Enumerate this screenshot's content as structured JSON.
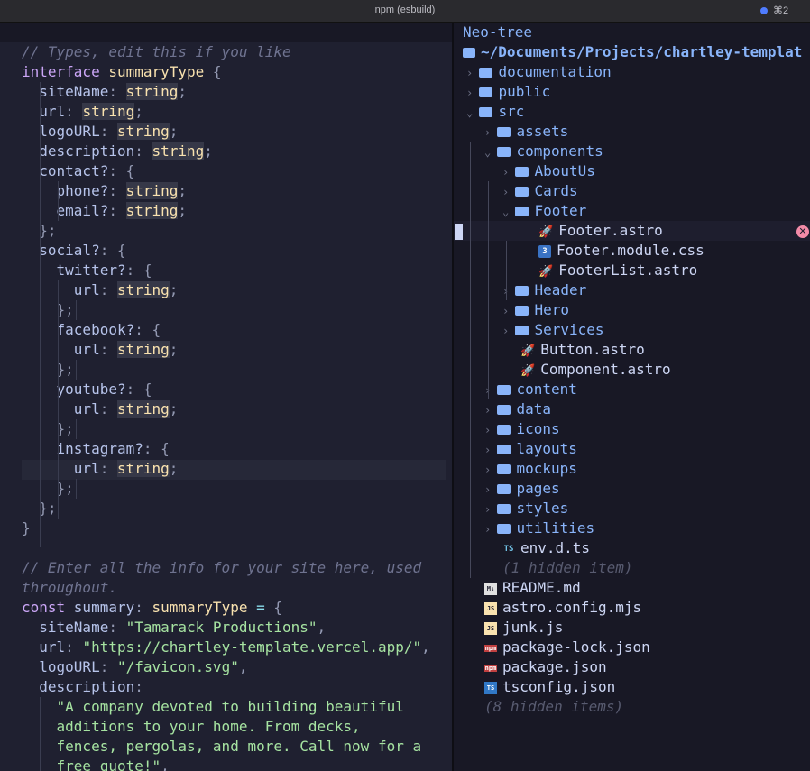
{
  "titlebar": {
    "title": "npm (esbuild)",
    "shortcut": "⌘2"
  },
  "editor": {
    "lines": [
      {
        "n": "l1",
        "segs": [
          [
            "c-cm",
            "// Types, edit this if you like"
          ]
        ]
      },
      {
        "n": "l2",
        "segs": [
          [
            "c-kw",
            "interface "
          ],
          [
            "c-ty",
            "summaryType "
          ],
          [
            "c-pun",
            "{"
          ]
        ]
      },
      {
        "n": "l3",
        "segs": [
          [
            "",
            "  "
          ],
          [
            "c-prop",
            "siteName"
          ],
          [
            "c-pun",
            ": "
          ],
          [
            "c-hl",
            "string"
          ],
          [
            "c-pun",
            ";"
          ]
        ]
      },
      {
        "n": "l4",
        "segs": [
          [
            "",
            "  "
          ],
          [
            "c-prop",
            "url"
          ],
          [
            "c-pun",
            ": "
          ],
          [
            "c-hl",
            "string"
          ],
          [
            "c-pun",
            ";"
          ]
        ]
      },
      {
        "n": "l5",
        "segs": [
          [
            "",
            "  "
          ],
          [
            "c-prop",
            "logoURL"
          ],
          [
            "c-pun",
            ": "
          ],
          [
            "c-hl",
            "string"
          ],
          [
            "c-pun",
            ";"
          ]
        ]
      },
      {
        "n": "l6",
        "segs": [
          [
            "",
            "  "
          ],
          [
            "c-prop",
            "description"
          ],
          [
            "c-pun",
            ": "
          ],
          [
            "c-hl",
            "string"
          ],
          [
            "c-pun",
            ";"
          ]
        ]
      },
      {
        "n": "l7",
        "segs": [
          [
            "",
            "  "
          ],
          [
            "c-prop",
            "contact?"
          ],
          [
            "c-pun",
            ": {"
          ]
        ]
      },
      {
        "n": "l8",
        "segs": [
          [
            "",
            "    "
          ],
          [
            "c-prop",
            "phone?"
          ],
          [
            "c-pun",
            ": "
          ],
          [
            "c-hl",
            "string"
          ],
          [
            "c-pun",
            ";"
          ]
        ]
      },
      {
        "n": "l9",
        "segs": [
          [
            "",
            "    "
          ],
          [
            "c-prop",
            "email?"
          ],
          [
            "c-pun",
            ": "
          ],
          [
            "c-hl",
            "string"
          ],
          [
            "c-pun",
            ";"
          ]
        ]
      },
      {
        "n": "l10",
        "segs": [
          [
            "c-pun",
            "  };"
          ]
        ]
      },
      {
        "n": "l11",
        "segs": [
          [
            "",
            "  "
          ],
          [
            "c-prop",
            "social?"
          ],
          [
            "c-pun",
            ": {"
          ]
        ]
      },
      {
        "n": "l12",
        "segs": [
          [
            "",
            "    "
          ],
          [
            "c-prop",
            "twitter?"
          ],
          [
            "c-pun",
            ": {"
          ]
        ]
      },
      {
        "n": "l13",
        "segs": [
          [
            "",
            "      "
          ],
          [
            "c-prop",
            "url"
          ],
          [
            "c-pun",
            ": "
          ],
          [
            "c-hl",
            "string"
          ],
          [
            "c-pun",
            ";"
          ]
        ]
      },
      {
        "n": "l14",
        "segs": [
          [
            "c-pun",
            "    };"
          ]
        ]
      },
      {
        "n": "l15",
        "segs": [
          [
            "",
            "    "
          ],
          [
            "c-prop",
            "facebook?"
          ],
          [
            "c-pun",
            ": {"
          ]
        ]
      },
      {
        "n": "l16",
        "segs": [
          [
            "",
            "      "
          ],
          [
            "c-prop",
            "url"
          ],
          [
            "c-pun",
            ": "
          ],
          [
            "c-hl",
            "string"
          ],
          [
            "c-pun",
            ";"
          ]
        ]
      },
      {
        "n": "l17",
        "segs": [
          [
            "c-pun",
            "    };"
          ]
        ]
      },
      {
        "n": "l18",
        "segs": [
          [
            "",
            "    "
          ],
          [
            "c-prop",
            "youtube?"
          ],
          [
            "c-pun",
            ": {"
          ]
        ]
      },
      {
        "n": "l19",
        "segs": [
          [
            "",
            "      "
          ],
          [
            "c-prop",
            "url"
          ],
          [
            "c-pun",
            ": "
          ],
          [
            "c-hl",
            "string"
          ],
          [
            "c-pun",
            ";"
          ]
        ]
      },
      {
        "n": "l20",
        "segs": [
          [
            "c-pun",
            "    };"
          ]
        ]
      },
      {
        "n": "l21",
        "segs": [
          [
            "",
            "    "
          ],
          [
            "c-prop",
            "instagram?"
          ],
          [
            "c-pun",
            ": {"
          ]
        ]
      },
      {
        "n": "l22",
        "segs": [
          [
            "",
            "      "
          ],
          [
            "c-prop",
            "url"
          ],
          [
            "c-pun",
            ": "
          ],
          [
            "c-hl",
            "string"
          ],
          [
            "c-pun",
            ";"
          ]
        ]
      },
      {
        "n": "l23",
        "segs": [
          [
            "c-pun",
            "    };"
          ]
        ]
      },
      {
        "n": "l24",
        "segs": [
          [
            "c-pun",
            "  };"
          ]
        ]
      },
      {
        "n": "l25",
        "segs": [
          [
            "c-pun",
            "}"
          ]
        ]
      },
      {
        "n": "l26",
        "segs": [
          [
            "",
            ""
          ]
        ]
      },
      {
        "n": "l27",
        "segs": [
          [
            "c-cm",
            "// Enter all the info for your site here, used"
          ]
        ]
      },
      {
        "n": "l28",
        "segs": [
          [
            "c-cm",
            "throughout."
          ]
        ]
      },
      {
        "n": "l29",
        "segs": [
          [
            "c-kw",
            "const "
          ],
          [
            "c-prop",
            "summary"
          ],
          [
            "c-pun",
            ": "
          ],
          [
            "c-ty",
            "summaryType "
          ],
          [
            "c-op",
            "= "
          ],
          [
            "c-pun",
            "{"
          ]
        ]
      },
      {
        "n": "l30",
        "segs": [
          [
            "",
            "  "
          ],
          [
            "c-prop",
            "siteName"
          ],
          [
            "c-pun",
            ": "
          ],
          [
            "c-str",
            "\"Tamarack Productions\""
          ],
          [
            "c-pun",
            ","
          ]
        ]
      },
      {
        "n": "l31",
        "segs": [
          [
            "",
            "  "
          ],
          [
            "c-prop",
            "url"
          ],
          [
            "c-pun",
            ": "
          ],
          [
            "c-str",
            "\"https://chartley-template.vercel.app/\""
          ],
          [
            "c-pun",
            ","
          ]
        ]
      },
      {
        "n": "l32",
        "segs": [
          [
            "",
            "  "
          ],
          [
            "c-prop",
            "logoURL"
          ],
          [
            "c-pun",
            ": "
          ],
          [
            "c-str",
            "\"/favicon.svg\""
          ],
          [
            "c-pun",
            ","
          ]
        ]
      },
      {
        "n": "l33",
        "segs": [
          [
            "",
            "  "
          ],
          [
            "c-prop",
            "description"
          ],
          [
            "c-pun",
            ":"
          ]
        ]
      },
      {
        "n": "l34",
        "segs": [
          [
            "",
            "    "
          ],
          [
            "c-str",
            "\"A company devoted to building beautiful"
          ]
        ]
      },
      {
        "n": "l35",
        "segs": [
          [
            "",
            "    "
          ],
          [
            "c-str",
            "additions to your home. From decks,"
          ]
        ]
      },
      {
        "n": "l36",
        "segs": [
          [
            "",
            "    "
          ],
          [
            "c-str",
            "fences, pergolas, and more. Call now for a"
          ]
        ]
      },
      {
        "n": "l37",
        "segs": [
          [
            "",
            "    "
          ],
          [
            "c-str",
            "free quote!\""
          ],
          [
            "c-pun",
            ","
          ]
        ]
      }
    ]
  },
  "tree": {
    "title": "Neo-tree",
    "root": "~/Documents/Projects/chartley-templat",
    "items": [
      {
        "label": "documentation",
        "kind": "folder",
        "depth": 1,
        "open": false
      },
      {
        "label": "public",
        "kind": "folder",
        "depth": 1,
        "open": false
      },
      {
        "label": "src",
        "kind": "folder",
        "depth": 1,
        "open": true
      },
      {
        "label": "assets",
        "kind": "folder",
        "depth": 2,
        "open": false
      },
      {
        "label": "components",
        "kind": "folder",
        "depth": 2,
        "open": true
      },
      {
        "label": "AboutUs",
        "kind": "folder",
        "depth": 3,
        "open": false
      },
      {
        "label": "Cards",
        "kind": "folder",
        "depth": 3,
        "open": false
      },
      {
        "label": "Footer",
        "kind": "folder",
        "depth": 3,
        "open": true
      },
      {
        "label": "Footer.astro",
        "kind": "astro",
        "depth": 4
      },
      {
        "label": "Footer.module.css",
        "kind": "css",
        "depth": 4
      },
      {
        "label": "FooterList.astro",
        "kind": "astro",
        "depth": 4
      },
      {
        "label": "Header",
        "kind": "folder",
        "depth": 3,
        "open": false
      },
      {
        "label": "Hero",
        "kind": "folder",
        "depth": 3,
        "open": false
      },
      {
        "label": "Services",
        "kind": "folder",
        "depth": 3,
        "open": false
      },
      {
        "label": "Button.astro",
        "kind": "astro",
        "depth": 3
      },
      {
        "label": "Component.astro",
        "kind": "astro",
        "depth": 3
      },
      {
        "label": "content",
        "kind": "folder",
        "depth": 2,
        "open": false
      },
      {
        "label": "data",
        "kind": "folder",
        "depth": 2,
        "open": false
      },
      {
        "label": "icons",
        "kind": "folder",
        "depth": 2,
        "open": false
      },
      {
        "label": "layouts",
        "kind": "folder",
        "depth": 2,
        "open": false
      },
      {
        "label": "mockups",
        "kind": "folder",
        "depth": 2,
        "open": false
      },
      {
        "label": "pages",
        "kind": "folder",
        "depth": 2,
        "open": false
      },
      {
        "label": "styles",
        "kind": "folder",
        "depth": 2,
        "open": false
      },
      {
        "label": "utilities",
        "kind": "folder",
        "depth": 2,
        "open": false
      },
      {
        "label": "env.d.ts",
        "kind": "ts",
        "depth": 2
      },
      {
        "label": "(1 hidden item)",
        "kind": "hidden",
        "depth": 2
      },
      {
        "label": "README.md",
        "kind": "md",
        "depth": 1
      },
      {
        "label": "astro.config.mjs",
        "kind": "js",
        "depth": 1
      },
      {
        "label": "junk.js",
        "kind": "js",
        "depth": 1
      },
      {
        "label": "package-lock.json",
        "kind": "npm",
        "depth": 1
      },
      {
        "label": "package.json",
        "kind": "npm",
        "depth": 1
      },
      {
        "label": "tsconfig.json",
        "kind": "tsbox",
        "depth": 1
      },
      {
        "label": "(8 hidden items)",
        "kind": "hidden",
        "depth": 1
      }
    ],
    "icon_glyphs": {
      "md": "M↓",
      "js": "JS",
      "npm": "npm",
      "tsbox": "TS",
      "css": "3",
      "ts": "TS"
    }
  }
}
